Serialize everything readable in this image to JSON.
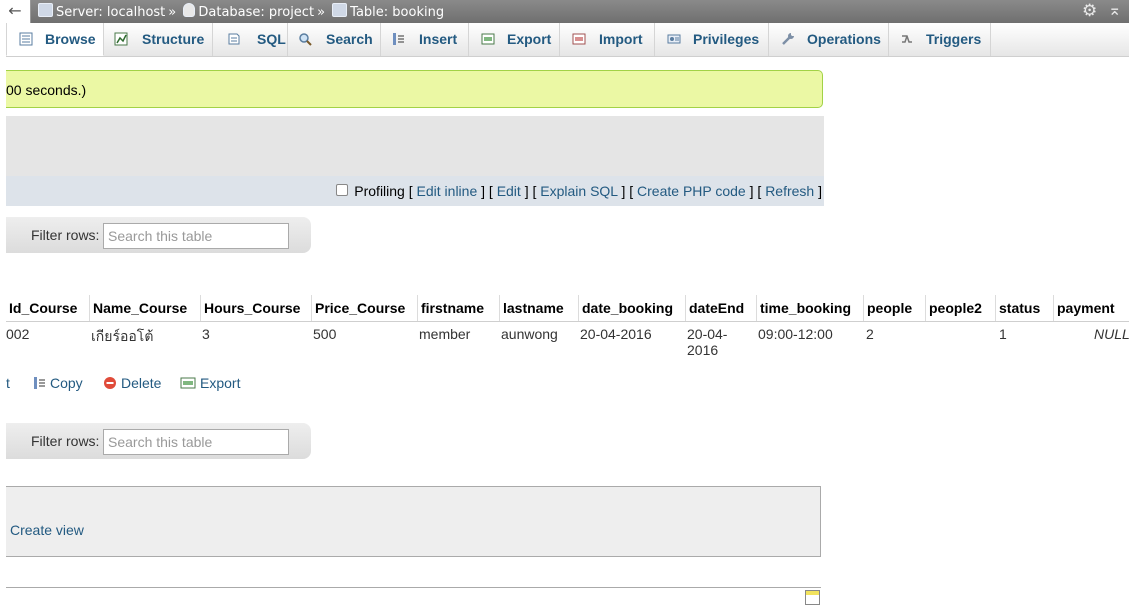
{
  "topbar": {
    "back_glyph": "←",
    "crumbs": [
      {
        "icon": "server-icon",
        "text": "Server: localhost",
        "sep": "»"
      },
      {
        "icon": "database-icon",
        "text": "Database: project",
        "sep": "»"
      },
      {
        "icon": "table-icon",
        "text": "Table: booking",
        "sep": ""
      }
    ],
    "gear_glyph": "⚙",
    "collapse_glyph": "⌅"
  },
  "tabs": [
    {
      "label": "Browse",
      "icon": "browse-icon",
      "active": true
    },
    {
      "label": "Structure",
      "icon": "structure-icon"
    },
    {
      "label": "SQL",
      "icon": "sql-icon"
    },
    {
      "label": "Search",
      "icon": "search-icon"
    },
    {
      "label": "Insert",
      "icon": "insert-icon"
    },
    {
      "label": "Export",
      "icon": "export-icon"
    },
    {
      "label": "Import",
      "icon": "import-icon"
    },
    {
      "label": "Privileges",
      "icon": "privileges-icon"
    },
    {
      "label": "Operations",
      "icon": "operations-icon"
    },
    {
      "label": "Triggers",
      "icon": "triggers-icon"
    }
  ],
  "message": {
    "text": "00 seconds.)"
  },
  "sql_options": {
    "profiling": "Profiling",
    "open": "[",
    "mid": "] [",
    "close": "]",
    "links": [
      "Edit inline",
      "Edit",
      "Explain SQL",
      "Create PHP code",
      "Refresh"
    ]
  },
  "filter": {
    "label": "Filter rows:",
    "placeholder": "Search this table"
  },
  "table": {
    "columns": [
      "Id_Course",
      "Name_Course",
      "Hours_Course",
      "Price_Course",
      "firstname",
      "lastname",
      "date_booking",
      "dateEnd",
      "time_booking",
      "people",
      "people2",
      "status",
      "payment"
    ],
    "rows": [
      [
        "002",
        "เกียร์ออโต้",
        "3",
        "500",
        "member",
        "aunwong",
        "20-04-2016",
        "20-04-2016",
        "09:00-12:00",
        "2",
        "",
        "1",
        "NULL"
      ]
    ]
  },
  "row_actions": {
    "edit": "t",
    "copy": "Copy",
    "delete": "Delete",
    "export": "Export"
  },
  "query_ops": {
    "create_view": "Create view"
  },
  "colors": {
    "accent": "#235a81",
    "success_bg": "#ebf8a4",
    "success_border": "#a2d246"
  }
}
